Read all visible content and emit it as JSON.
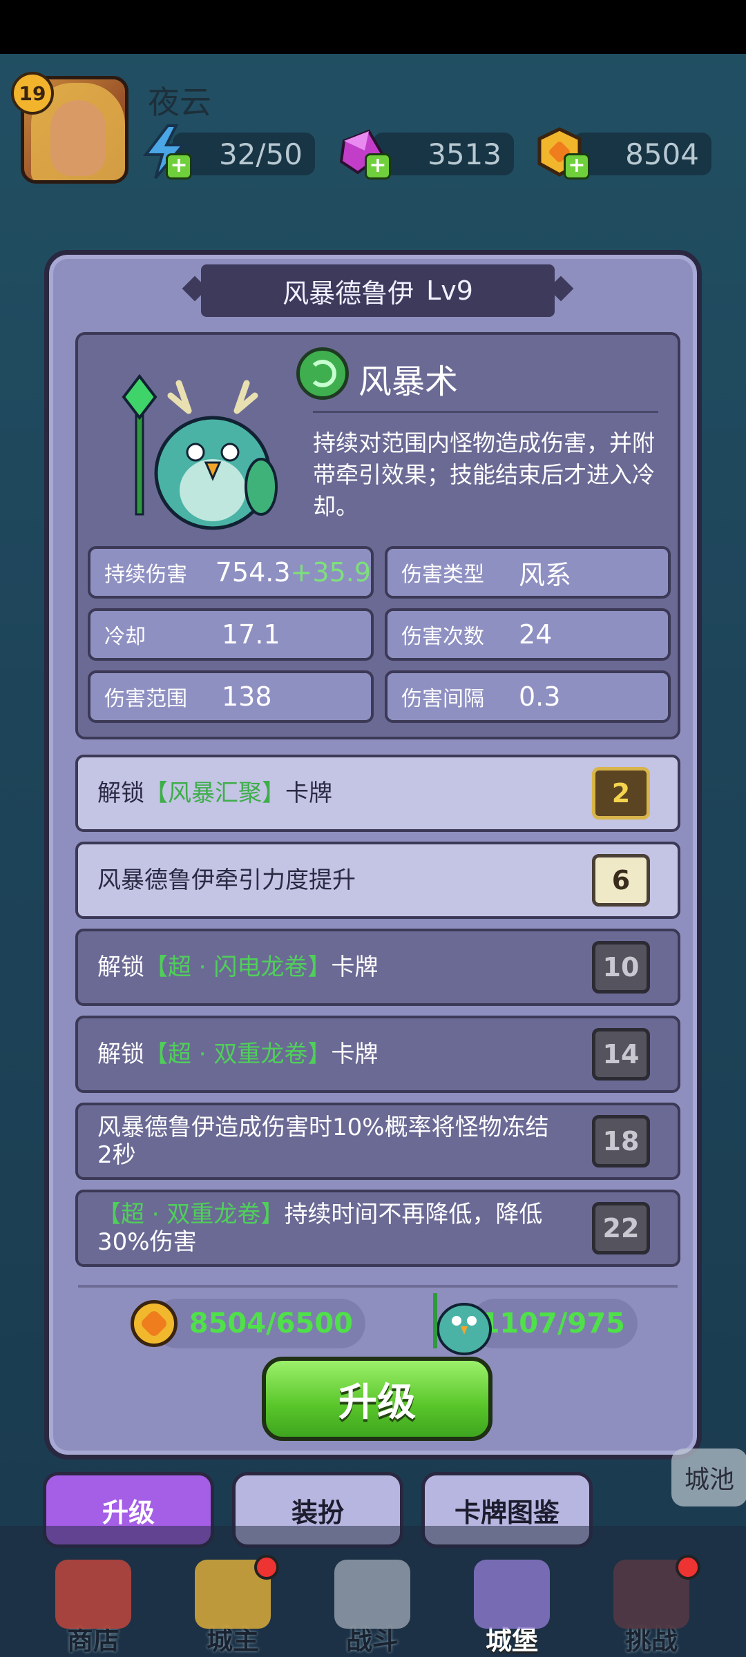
{
  "player": {
    "level": "19",
    "name": "夜云",
    "energy": "32/50",
    "gems": "3513",
    "gold": "8504"
  },
  "modal": {
    "hero_name": "风暴德鲁伊",
    "hero_level": "Lv9",
    "skill": {
      "name": "风暴术",
      "description": "持续对范围内怪物造成伤害，并附带牵引效果；技能结束后才进入冷却。"
    },
    "stats": [
      {
        "label": "持续伤害",
        "value": "754.3",
        "bonus": "+35.9"
      },
      {
        "label": "伤害类型",
        "value": "风系",
        "bonus": ""
      },
      {
        "label": "冷却",
        "value": "17.1",
        "bonus": ""
      },
      {
        "label": "伤害次数",
        "value": "24",
        "bonus": ""
      },
      {
        "label": "伤害范围",
        "value": "138",
        "bonus": ""
      },
      {
        "label": "伤害间隔",
        "value": "0.3",
        "bonus": ""
      }
    ],
    "upgrades": [
      {
        "pre": "解锁",
        "highlight": "【风暴汇聚】",
        "post": "卡牌",
        "level": "2",
        "state": "unlocked"
      },
      {
        "pre": "风暴德鲁伊牵引力度提升",
        "highlight": "",
        "post": "",
        "level": "6",
        "state": "unlocked"
      },
      {
        "pre": "解锁",
        "highlight": "【超 · 闪电龙卷】",
        "post": "卡牌",
        "level": "10",
        "state": "locked"
      },
      {
        "pre": "解锁",
        "highlight": "【超 · 双重龙卷】",
        "post": "卡牌",
        "level": "14",
        "state": "locked"
      },
      {
        "pre": "风暴德鲁伊造成伤害时10%概率将怪物冻结2秒",
        "highlight": "",
        "post": "",
        "level": "18",
        "state": "locked"
      },
      {
        "pre": "",
        "highlight": "【超 · 双重龙卷】",
        "post": "持续时间不再降低，降低30%伤害",
        "level": "22",
        "state": "locked"
      }
    ],
    "cost_gold": "8504/6500",
    "cost_shards": "1107/975",
    "upgrade_button": "升级"
  },
  "tabs": {
    "upgrade": "升级",
    "skin": "装扮",
    "cards": "卡牌图鉴"
  },
  "side_chip": "城池",
  "nav": {
    "shop": "商店",
    "lord": "城主",
    "battle": "战斗",
    "castle": "城堡",
    "challenge": "挑战"
  },
  "colors": {
    "accent_purple": "#a45fe6",
    "green": "#4fe04a",
    "modal_bg": "#8e8fbf"
  }
}
